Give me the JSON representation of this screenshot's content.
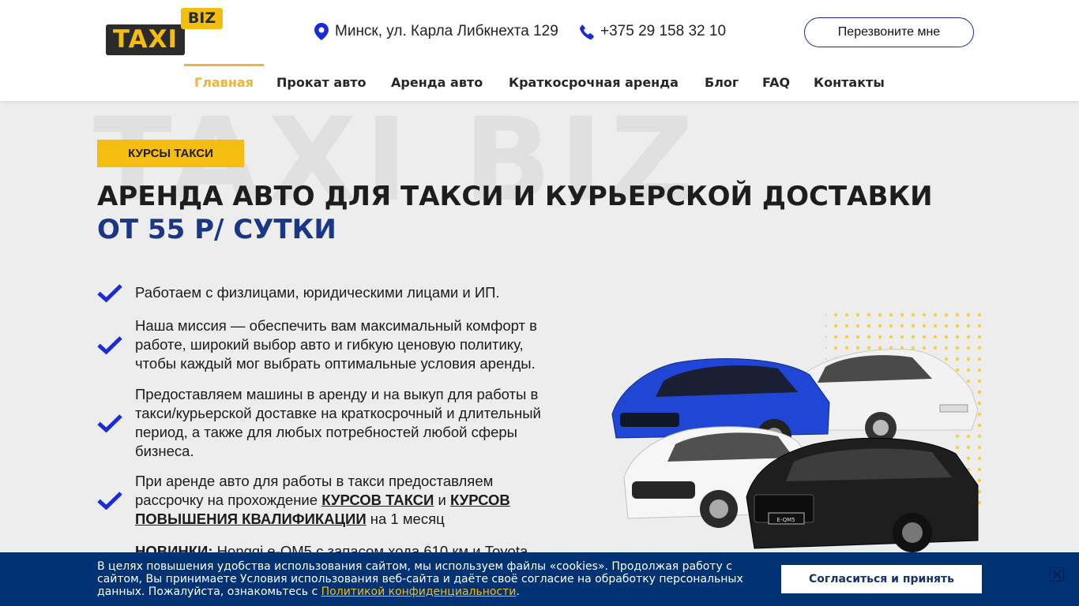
{
  "header": {
    "logo": {
      "taxi": "TAXI",
      "biz": "BIZ"
    },
    "address": "Минск, ул. Карла Либкнехта 129",
    "phone": "+375 29 158 32 10",
    "callback_label": "Перезвоните мне"
  },
  "nav": [
    {
      "label": "Главная",
      "active": true
    },
    {
      "label": "Прокат авто"
    },
    {
      "label": "Аренда авто"
    },
    {
      "label": "Краткосрочная аренда"
    },
    {
      "label": "Блог"
    },
    {
      "label": "FAQ"
    },
    {
      "label": "Контакты"
    }
  ],
  "hero": {
    "watermark": "TAXI BIZ",
    "badge": "КУРСЫ ТАКСИ",
    "title": "АРЕНДА АВТО ДЛЯ ТАКСИ И КУРЬЕРСКОЙ ДОСТАВКИ",
    "subtitle": "ОТ 55 Р/ СУТКИ",
    "features": [
      {
        "text": "Работаем с физлицами, юридическими лицами и ИП."
      },
      {
        "text": "Наша миссия — обеспечить вам максимальный комфорт в работе, широкий выбор авто и гибкую ценовую политику, чтобы каждый мог выбрать оптимальные условия аренды."
      },
      {
        "text": "Предоставляем машины в аренду и на выкуп для работы в такси/курьерской доставке на краткосрочный и длительный период, а также для любых потребностей любой сферы бизнеса."
      },
      {
        "text_a": "При аренде авто для работы в такси предоставляем рассрочку на прохождение ",
        "link_1": "КУРСОВ ТАКСИ",
        "text_b": " и ",
        "link_2": "КУРСОВ ПОВЫШЕНИЯ КВАЛИФИКАЦИИ",
        "text_c": " на 1 месяц"
      },
      {
        "bold": "НОВИНКИ:",
        "text": " Hongqi e-QM5 с запасом хода 610 км и Toyota"
      }
    ],
    "car_plate": "E-QM5"
  },
  "cookie": {
    "text": "В целях повышения удобства использования сайтом, мы используем файлы «cookies». Продолжая работу с сайтом, Вы принимаете Условия использования веб-сайта и даёте своё согласие на обработку персональных данных. Пожалуйста, ознакомьтесь с ",
    "link": "Политикой конфиденциальности",
    "suffix": ".",
    "accept_label": "Согласиться и принять"
  },
  "colors": {
    "accent_yellow": "#f5bd0f",
    "brand_blue": "#1a3787",
    "check_blue": "#1a2bd8",
    "cookie_bg": "#003274"
  }
}
